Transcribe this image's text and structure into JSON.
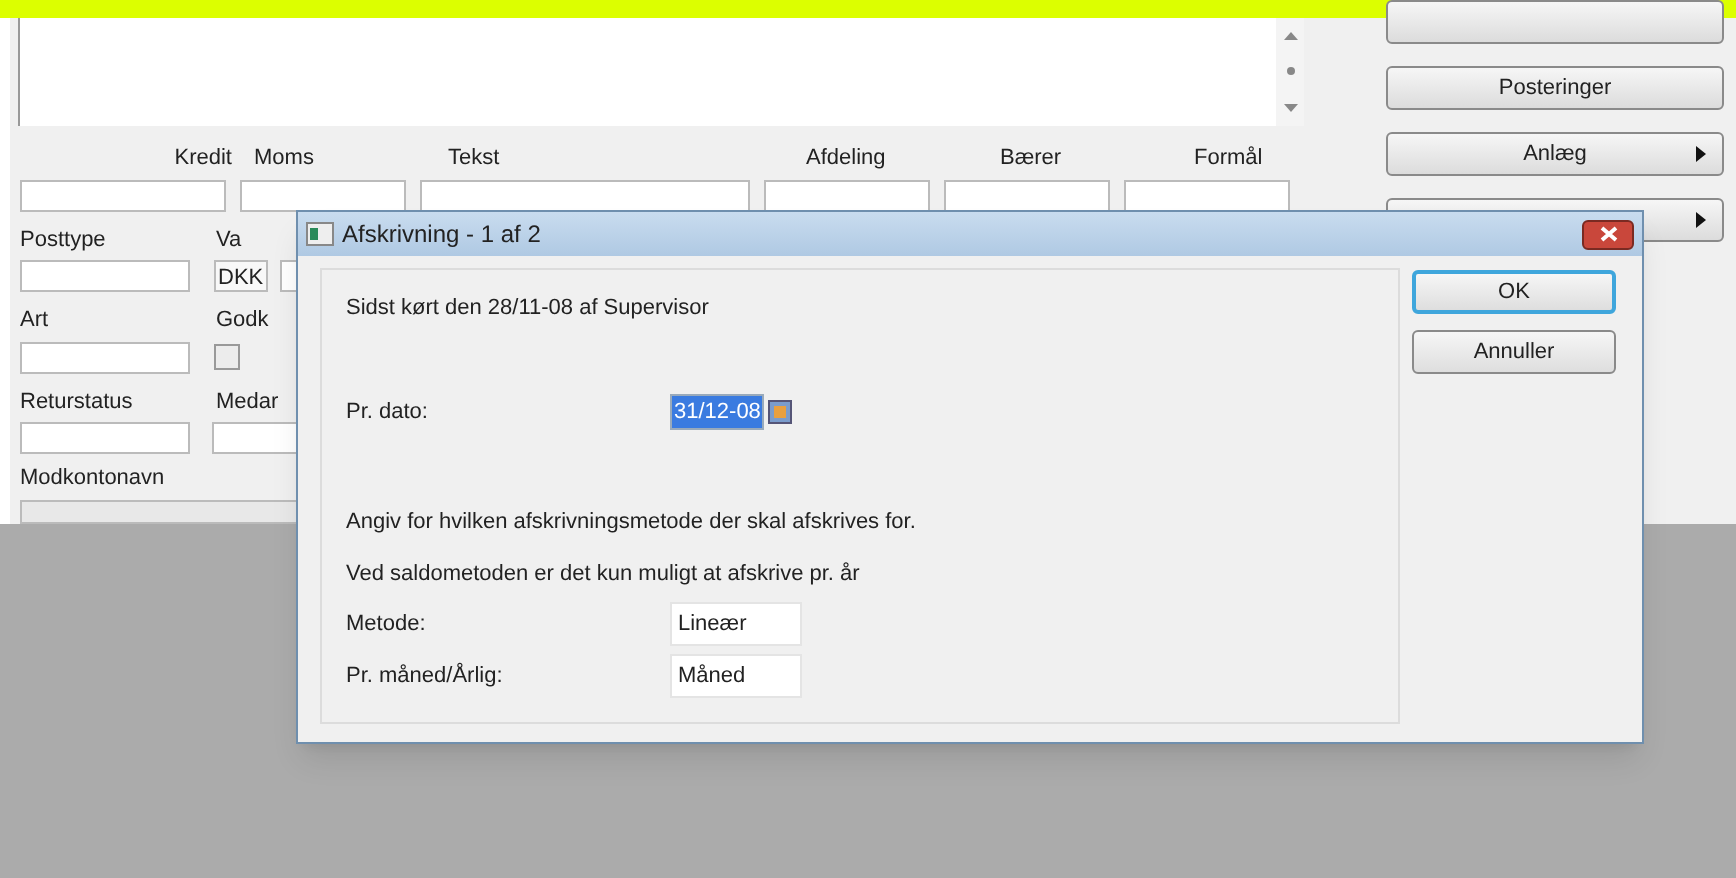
{
  "side_buttons": [
    {
      "submenu": false
    },
    {
      "label": "Posteringer",
      "submenu": false
    },
    {
      "label": "Anlæg",
      "submenu": true
    },
    {
      "submenu": true
    }
  ],
  "header_labels": [
    "Kredit",
    "Moms",
    "Tekst",
    "Afdeling",
    "Bærer",
    "Formål"
  ],
  "form_rows": [
    {
      "labels": [
        "Posttype",
        "Va"
      ],
      "kind": "currency",
      "value": "DKK"
    },
    {
      "labels": [
        "Art",
        "Godk"
      ],
      "kind": "checkbox",
      "checked": false
    },
    {
      "labels": [
        "Returstatus",
        "Medar"
      ],
      "kind": "field"
    }
  ],
  "bottom_label": "Modkontonavn",
  "dialog": {
    "title": "Afskrivning - 1 af 2",
    "last_run": "Sidst kørt den 28/11-08 af Supervisor",
    "date_label": "Pr. dato:",
    "date_value": "31/12-08",
    "info": [
      "Angiv for hvilken afskrivningsmetode der skal afskrives for.",
      "Ved saldometoden er det kun muligt at afskrive pr. år"
    ],
    "fields": [
      {
        "label": "Metode:",
        "value": "Lineær"
      },
      {
        "label": "Pr. måned/Årlig:",
        "value": "Måned"
      }
    ],
    "buttons": [
      {
        "label": "OK",
        "default": true
      },
      {
        "label": "Annuller",
        "default": false
      }
    ]
  }
}
